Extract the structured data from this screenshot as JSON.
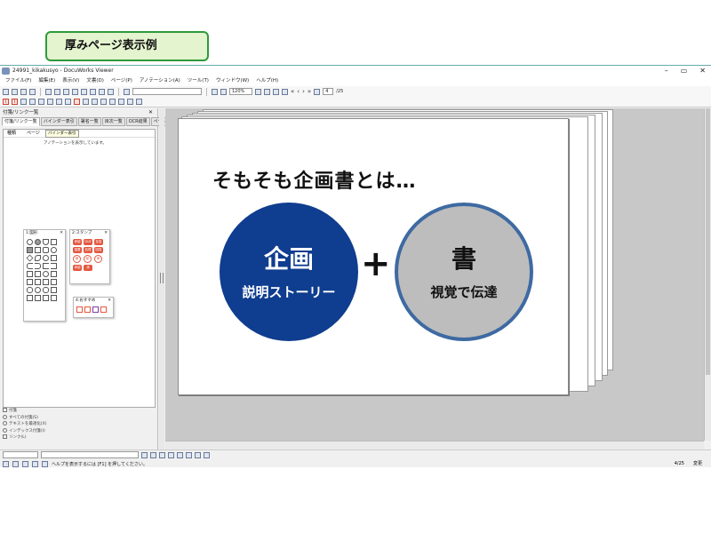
{
  "callout": "厚みページ表示例",
  "window": {
    "title": "24991_kikakusyo - DocuWorks Viewer",
    "minimize": "–",
    "maximize": "▭",
    "close": "✕"
  },
  "menu": [
    "ファイル(F)",
    "編集(E)",
    "表示(V)",
    "文書(D)",
    "ページ(P)",
    "アノテーション(A)",
    "ツール(T)",
    "ウィンドウ(W)",
    "ヘルプ(H)"
  ],
  "toolbar": {
    "zoom": "120%",
    "page_current": "4",
    "page_total": "/25"
  },
  "left_pane": {
    "title": "付箋/リンク一覧",
    "close": "✕",
    "tabs": [
      "付箋/リンク一覧",
      "バインダー表引",
      "署名一覧",
      "目次一覧",
      "OCR結果",
      "ページ属性"
    ],
    "columns": [
      "種類",
      "ページ",
      "内容"
    ],
    "tooltip": "バインダー表引",
    "note": "アノテーションを表示しています。",
    "palettes": {
      "shapes": "1:図形",
      "stamps": "2:スタンプ",
      "favorites": "4:おすすめ"
    },
    "stamps": [
      "承認",
      "DUE",
      "至急",
      "重要",
      "処理済",
      "回覧",
      "極",
      "秘",
      "承",
      "承認",
      "済"
    ],
    "options": {
      "sticky": "付箋",
      "all": "すべての付箋(S)",
      "text_adjust": "テキストを最適化(X)",
      "index": "インデックス付箋(I)",
      "link": "リンク(L)"
    }
  },
  "slide": {
    "headline": "そもそも企画書とは…",
    "left_circle": {
      "main": "企画",
      "sub": "説明ストーリー",
      "color": "#0f3d8f"
    },
    "plus": "+",
    "right_circle": {
      "main": "書",
      "sub": "視覚で伝達",
      "color": "#bdbdbd",
      "border": "#3e6aa2"
    }
  },
  "status": {
    "help": "ヘルプを表示するには [F1] を押してください。",
    "page": "4/25",
    "mode": "変更"
  }
}
